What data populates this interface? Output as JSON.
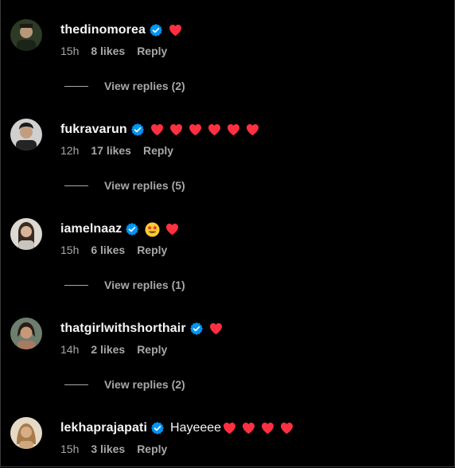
{
  "comments": [
    {
      "username": "thedinomorea",
      "text": "",
      "hearts": 1,
      "star_eyes": false,
      "time": "15h",
      "likes": "8 likes",
      "reply_label": "Reply",
      "view_replies": "View replies (2)",
      "avatar_colors": [
        "#4a5a3a",
        "#1e2a20",
        "#c8a888"
      ]
    },
    {
      "username": "fukravarun",
      "text": "",
      "hearts": 6,
      "star_eyes": false,
      "time": "12h",
      "likes": "17 likes",
      "reply_label": "Reply",
      "view_replies": "View replies (5)",
      "avatar_colors": [
        "#d8d8d8",
        "#2a2a2a",
        "#c9a084"
      ]
    },
    {
      "username": "iamelnaaz",
      "text": "",
      "hearts": 1,
      "star_eyes": true,
      "time": "15h",
      "likes": "6 likes",
      "reply_label": "Reply",
      "view_replies": "View replies (1)",
      "avatar_colors": [
        "#e0ddd8",
        "#3a2a22",
        "#d8b8a0"
      ]
    },
    {
      "username": "thatgirlwithshorthair",
      "text": "",
      "hearts": 1,
      "star_eyes": false,
      "time": "14h",
      "likes": "2 likes",
      "reply_label": "Reply",
      "view_replies": "View replies (2)",
      "avatar_colors": [
        "#7a8a7a",
        "#2a1e18",
        "#c89c7c"
      ]
    },
    {
      "username": "lekhaprajapati",
      "text": "Hayeeee",
      "hearts": 4,
      "star_eyes": false,
      "time": "15h",
      "likes": "3 likes",
      "reply_label": "Reply",
      "view_replies": "",
      "avatar_colors": [
        "#e8dcc8",
        "#b08858",
        "#d8b090"
      ]
    }
  ],
  "colors": {
    "background": "#000000",
    "text_primary": "#f5f5f5",
    "text_secondary": "#a8a8a8",
    "verified_badge": "#0095f6",
    "heart": "#ff3040"
  }
}
